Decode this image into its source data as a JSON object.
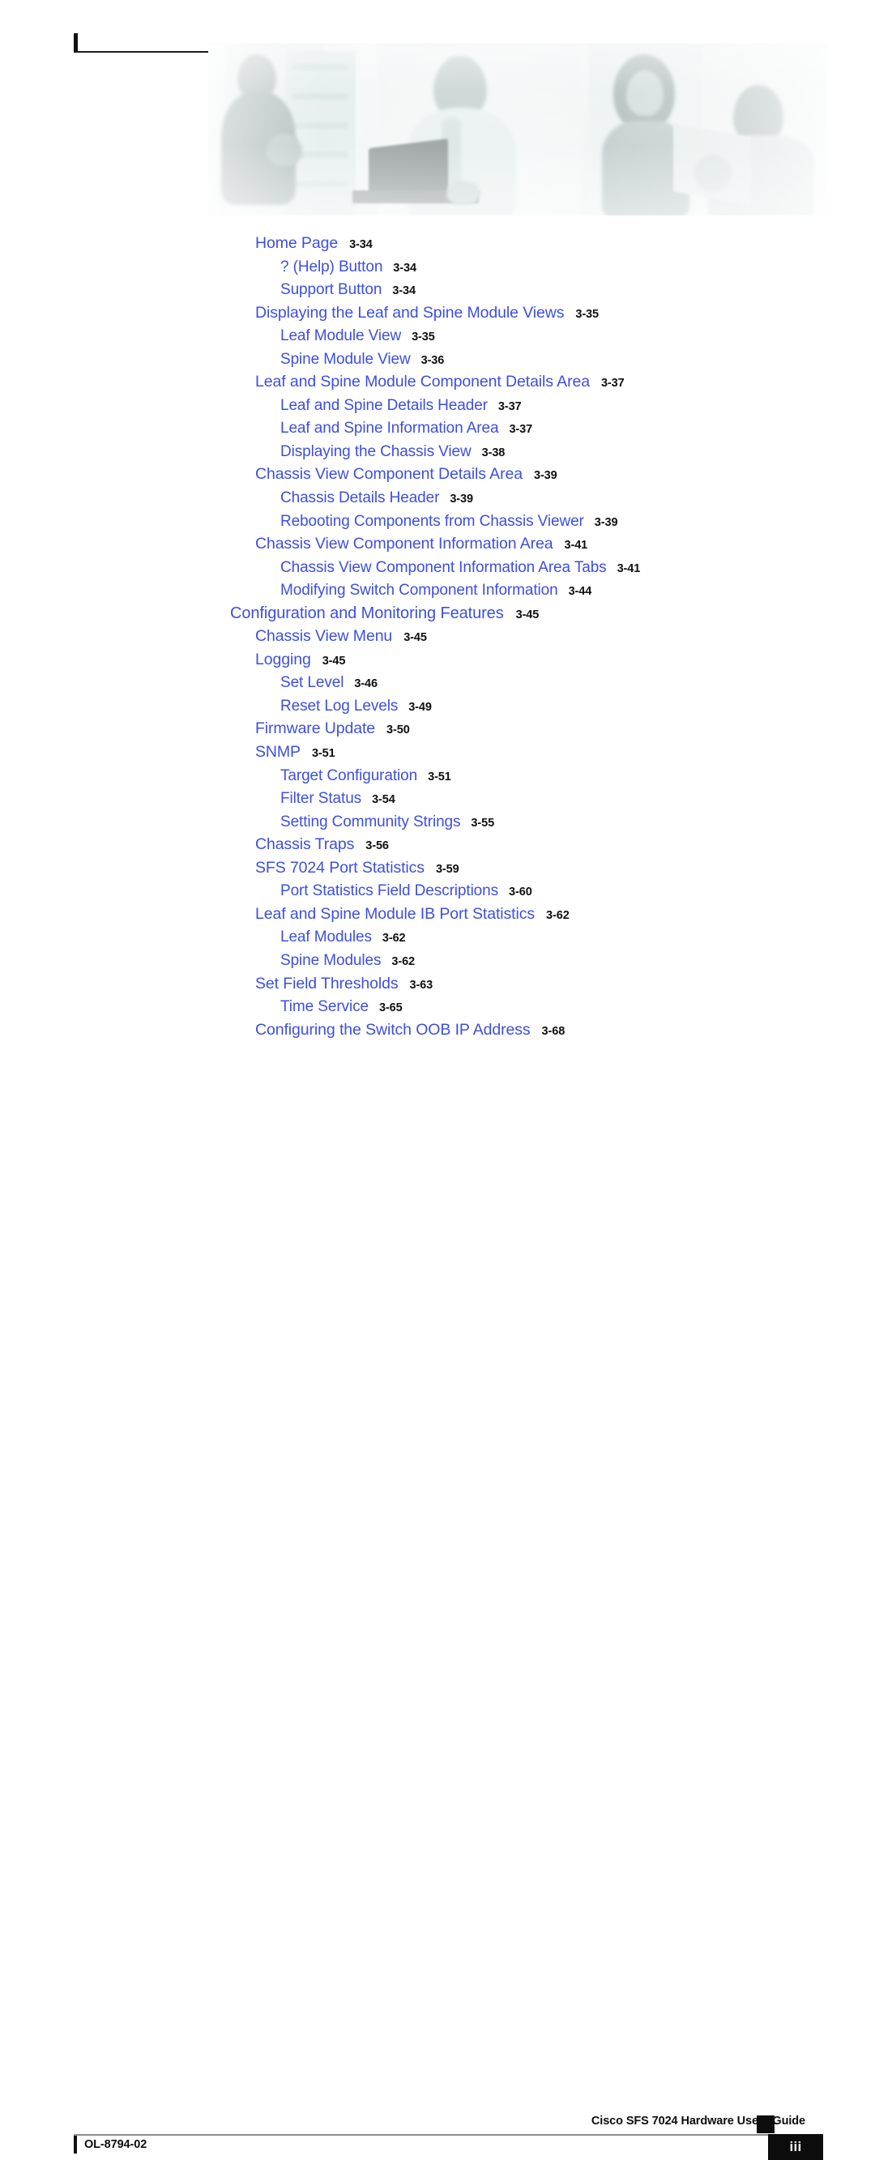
{
  "document": {
    "guide_title": "Cisco SFS 7024 Hardware Users Guide",
    "doc_number": "OL-8794-02",
    "page_number": "iii"
  },
  "banner": {
    "alt": "faded photograph of people working with networking equipment and a laptop"
  },
  "colors": {
    "link_blue": "#3d4fe0",
    "page_black": "#101010",
    "footer_black": "#0d0d0d",
    "banner_tint": "#e9f0ef"
  },
  "toc": {
    "entries": [
      {
        "title": "Home Page",
        "page": "3-34",
        "level": 1
      },
      {
        "title": "? (Help) Button",
        "page": "3-34",
        "level": 2
      },
      {
        "title": "Support Button",
        "page": "3-34",
        "level": 2
      },
      {
        "title": "Displaying the Leaf and Spine Module Views",
        "page": "3-35",
        "level": 1
      },
      {
        "title": "Leaf Module View",
        "page": "3-35",
        "level": 2
      },
      {
        "title": "Spine Module View",
        "page": "3-36",
        "level": 2
      },
      {
        "title": "Leaf and Spine Module Component Details Area",
        "page": "3-37",
        "level": 1
      },
      {
        "title": "Leaf and Spine Details Header",
        "page": "3-37",
        "level": 2
      },
      {
        "title": "Leaf and Spine Information Area",
        "page": "3-37",
        "level": 2
      },
      {
        "title": "Displaying the Chassis View",
        "page": "3-38",
        "level": 2
      },
      {
        "title": "Chassis View Component Details Area",
        "page": "3-39",
        "level": 1
      },
      {
        "title": "Chassis Details Header",
        "page": "3-39",
        "level": 2
      },
      {
        "title": "Rebooting Components from Chassis Viewer",
        "page": "3-39",
        "level": 2
      },
      {
        "title": "Chassis View Component Information Area",
        "page": "3-41",
        "level": 1
      },
      {
        "title": "Chassis View Component Information Area Tabs",
        "page": "3-41",
        "level": 2
      },
      {
        "title": "Modifying Switch Component Information",
        "page": "3-44",
        "level": 2
      },
      {
        "title": "Configuration and Monitoring Features",
        "page": "3-45",
        "level": 0
      },
      {
        "title": "Chassis View Menu",
        "page": "3-45",
        "level": 1
      },
      {
        "title": "Logging",
        "page": "3-45",
        "level": 1
      },
      {
        "title": "Set Level",
        "page": "3-46",
        "level": 2
      },
      {
        "title": "Reset Log Levels",
        "page": "3-49",
        "level": 2
      },
      {
        "title": "Firmware Update",
        "page": "3-50",
        "level": 1
      },
      {
        "title": "SNMP",
        "page": "3-51",
        "level": 1
      },
      {
        "title": "Target Configuration",
        "page": "3-51",
        "level": 2
      },
      {
        "title": "Filter Status",
        "page": "3-54",
        "level": 2
      },
      {
        "title": "Setting Community Strings",
        "page": "3-55",
        "level": 2
      },
      {
        "title": "Chassis Traps",
        "page": "3-56",
        "level": 1
      },
      {
        "title": "SFS 7024 Port Statistics",
        "page": "3-59",
        "level": 1
      },
      {
        "title": "Port Statistics Field Descriptions",
        "page": "3-60",
        "level": 2
      },
      {
        "title": "Leaf and Spine Module IB Port Statistics",
        "page": "3-62",
        "level": 1
      },
      {
        "title": "Leaf Modules",
        "page": "3-62",
        "level": 2
      },
      {
        "title": "Spine Modules",
        "page": "3-62",
        "level": 2
      },
      {
        "title": "Set Field Thresholds",
        "page": "3-63",
        "level": 1
      },
      {
        "title": "Time Service",
        "page": "3-65",
        "level": 2
      },
      {
        "title": "Configuring the Switch OOB IP Address",
        "page": "3-68",
        "level": 1
      }
    ]
  }
}
